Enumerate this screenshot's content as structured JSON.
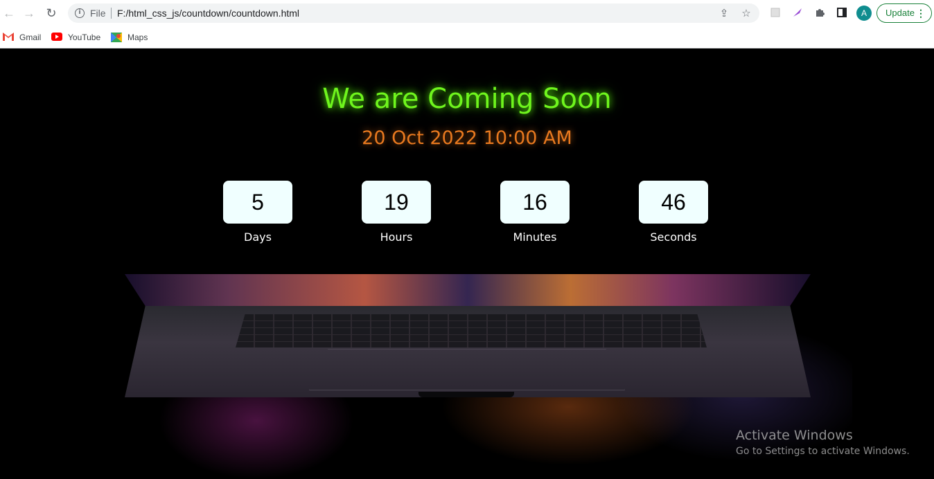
{
  "browser": {
    "file_label": "File",
    "url": "F:/html_css_js/countdown/countdown.html",
    "avatar_letter": "A",
    "update_label": "Update",
    "menu_icon": "⋮",
    "icons": [
      "back-icon",
      "forward-icon",
      "reload-icon",
      "info-icon",
      "share-icon",
      "star-icon",
      "extension-icon",
      "puzzle-icon",
      "sidepanel-icon"
    ]
  },
  "bookmarks": [
    {
      "label": "Gmail"
    },
    {
      "label": "YouTube"
    },
    {
      "label": "Maps"
    }
  ],
  "page": {
    "title": "We are Coming Soon",
    "date": "20 Oct 2022 10:00 AM",
    "countdown": [
      {
        "value": "5",
        "label": "Days"
      },
      {
        "value": "19",
        "label": "Hours"
      },
      {
        "value": "16",
        "label": "Minutes"
      },
      {
        "value": "46",
        "label": "Seconds"
      }
    ],
    "colors": {
      "title": "#6ff51d",
      "date": "#e8791f",
      "box": "#f0ffff",
      "background": "#000000"
    }
  },
  "watermark": {
    "title": "Activate Windows",
    "subtitle": "Go to Settings to activate Windows."
  }
}
